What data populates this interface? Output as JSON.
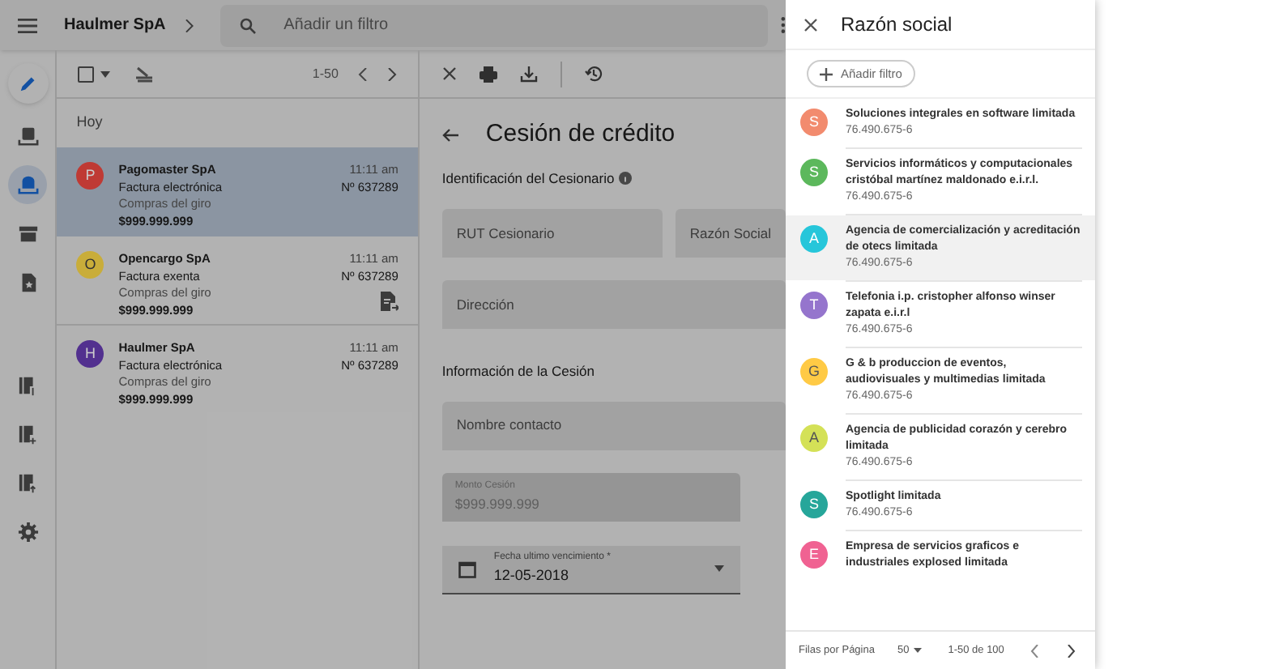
{
  "app_bar": {
    "company": "Haulmer SpA",
    "search": {
      "placeholder": "Añadir un filtro"
    }
  },
  "sidebar": {
    "items": [
      {
        "kind": "inbox",
        "selected": false
      },
      {
        "kind": "outbox",
        "selected": true
      },
      {
        "kind": "archive",
        "selected": false
      },
      {
        "kind": "starred",
        "selected": false
      },
      {
        "kind": "doc-dollar",
        "selected": false
      },
      {
        "kind": "doc-plus",
        "selected": false
      },
      {
        "kind": "doc-up",
        "selected": false
      },
      {
        "kind": "settings",
        "selected": false
      }
    ]
  },
  "list": {
    "checkbox": {
      "checked": false
    },
    "pagination": "1-50",
    "section": "Hoy",
    "items": [
      {
        "initial": "P",
        "color": "#bf3a34",
        "name": "Pagomaster SpA",
        "type": "Factura electrónica",
        "category": "Compras del giro",
        "amount": "$999.999.999",
        "time": "11:11 am",
        "number": "Nº 637289",
        "selected": true,
        "ceded": false
      },
      {
        "initial": "O",
        "color": "#c9ad3a",
        "name": "Opencargo SpA",
        "type": "Factura exenta",
        "category": "Compras del giro",
        "amount": "$999.999.999",
        "time": "11:11 am",
        "number": "Nº 637289",
        "selected": false,
        "ceded": true
      },
      {
        "initial": "H",
        "color": "#52308f",
        "name": "Haulmer SpA",
        "type": "Factura electrónica",
        "category": "Compras del giro",
        "amount": "$999.999.999",
        "time": "11:11 am",
        "number": "Nº 637289",
        "selected": false,
        "ceded": false
      }
    ]
  },
  "detail": {
    "title": "Cesión de crédito",
    "section_1": "Identificación del Cesionario",
    "fields_1": [
      {
        "placeholder": "RUT Cesionario"
      },
      {
        "placeholder": "Razón Social"
      }
    ],
    "address": {
      "placeholder": "Dirección"
    },
    "section_2": "Información de la Cesión",
    "contact": {
      "placeholder": "Nombre contacto"
    },
    "amount": {
      "label": "Monto Cesión",
      "value": "$999.999.999",
      "disabled": true
    },
    "due_date": {
      "label": "Fecha ultimo vencimiento *",
      "value": "12-05-2018"
    }
  },
  "panel": {
    "title": "Razón social",
    "add_filter": "Añadir filtro",
    "items": [
      {
        "initial": "S",
        "color": "#f28b6e",
        "name": "Soluciones integrales en software limitada",
        "rut": "76.490.675-6",
        "highlighted": false
      },
      {
        "initial": "S",
        "color": "#5cb85c",
        "name": "Servicios informáticos y computacionales cristóbal martínez maldonado e.i.r.l.",
        "rut": "76.490.675-6",
        "highlighted": false
      },
      {
        "initial": "A",
        "color": "#26c6da",
        "name": "Agencia de comercialización y acreditación de otecs limitada",
        "rut": "76.490.675-6",
        "highlighted": true
      },
      {
        "initial": "T",
        "color": "#9575cd",
        "name": "Telefonia i.p. cristopher alfonso winser zapata e.i.r.l",
        "rut": "76.490.675-6",
        "highlighted": false
      },
      {
        "initial": "G",
        "color": "#ffca45",
        "name": "G & b produccion de eventos, audiovisuales y multimedias limitada",
        "rut": "76.490.675-6",
        "highlighted": false
      },
      {
        "initial": "A",
        "color": "#d4e157",
        "name": "Agencia de publicidad corazón y cerebro limitada",
        "rut": "76.490.675-6",
        "highlighted": false
      },
      {
        "initial": "S",
        "color": "#26a69a",
        "name": "Spotlight limitada",
        "rut": "76.490.675-6",
        "highlighted": false
      },
      {
        "initial": "E",
        "color": "#f06292",
        "name": "Empresa de servicios graficos e industriales explosed limitada",
        "highlighted": false
      }
    ],
    "footer": {
      "rows_label": "Filas por Página",
      "rows_value": "50",
      "range": "1-50 de 100"
    }
  }
}
